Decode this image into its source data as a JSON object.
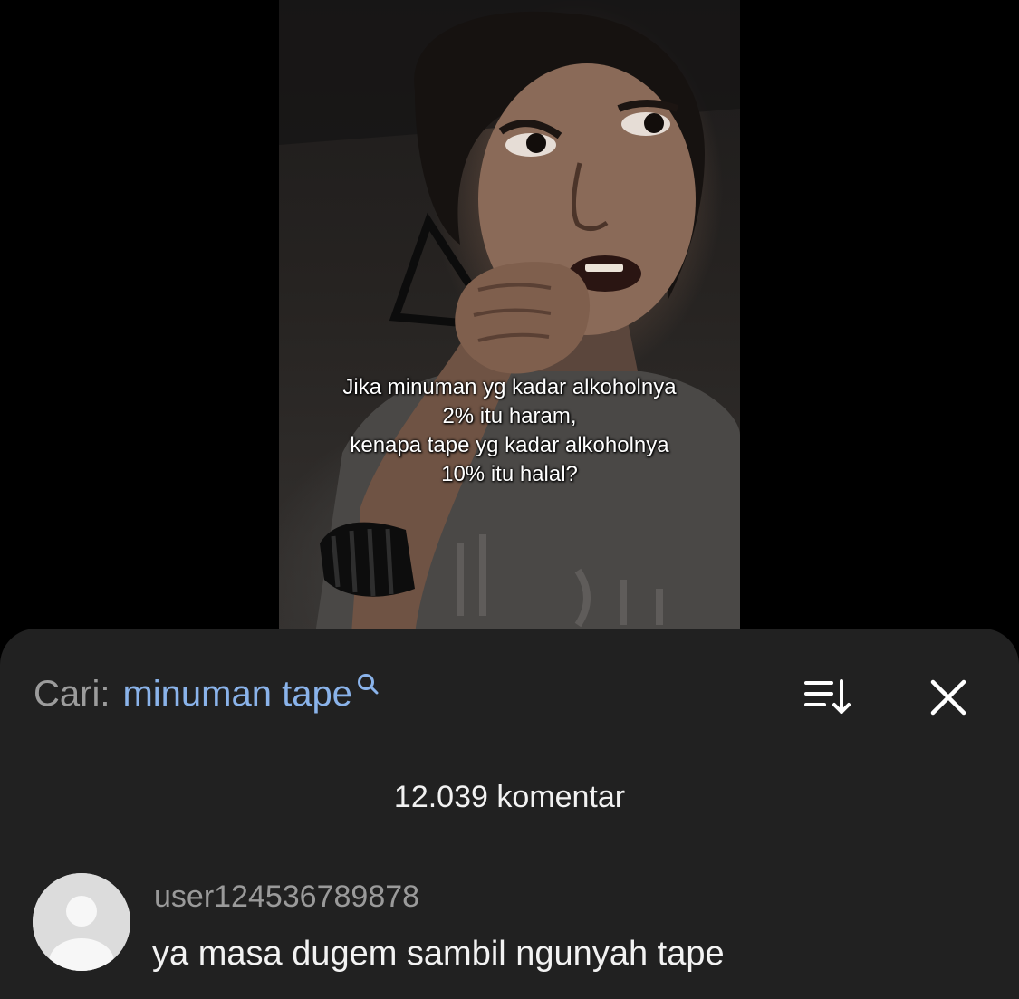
{
  "video": {
    "caption_lines": [
      "Jika minuman yg kadar alkoholnya",
      "2% itu haram,",
      "kenapa tape yg kadar alkoholnya",
      "10% itu halal?"
    ]
  },
  "comments_panel": {
    "search_prefix": "Cari:",
    "search_term": "minuman tape",
    "search_icon": "search-icon",
    "sort_icon": "sort-icon",
    "close_icon": "close-icon",
    "comment_count": "12.039 komentar",
    "comments": [
      {
        "username": "user124536789878",
        "text": "ya masa dugem sambil ngunyah tape",
        "avatar": "default-avatar-icon"
      }
    ]
  },
  "colors": {
    "sheet_background": "#212121",
    "search_term": "#8ab3ea",
    "muted_text": "#9c9c9c",
    "primary_text": "#f2f2f2"
  }
}
